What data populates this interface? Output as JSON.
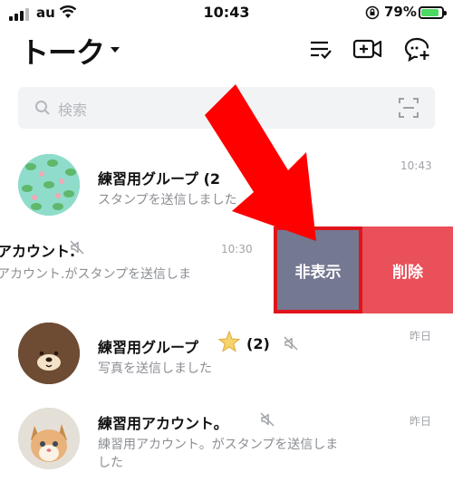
{
  "status_bar": {
    "carrier": "au",
    "time": "10:43",
    "battery": "79%"
  },
  "header": {
    "title": "トーク"
  },
  "search": {
    "placeholder": "検索"
  },
  "chats": [
    {
      "name": "練習用グループ (2",
      "message": "スタンプを送信しました",
      "time": "10:43"
    },
    {
      "name": "アカウント.",
      "message": "アカウント.がスタンプを送信しま",
      "time": "10:30"
    },
    {
      "name": "練習用グループ",
      "count": "(2)",
      "message": "写真を送信しました",
      "time": "昨日"
    },
    {
      "name": "練習用アカウント。",
      "message_line1": "練習用アカウント。がスタンプを送信しま",
      "message_line2": "した",
      "time": "昨日"
    }
  ],
  "swipe_actions": {
    "hide_label": "非表示",
    "delete_label": "削除"
  },
  "colors": {
    "hide_bg": "#747891",
    "delete_bg": "#e9505a",
    "highlight": "#e0141c",
    "arrow": "#ff0000"
  }
}
